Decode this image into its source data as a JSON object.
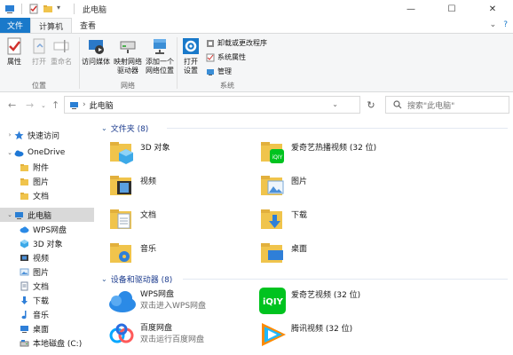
{
  "window": {
    "title": "此电脑",
    "controls": [
      "—",
      "☐",
      "✕"
    ]
  },
  "ribbon_tabs": {
    "file": "文件",
    "computer": "计算机",
    "view": "查看"
  },
  "ribbon": {
    "location": {
      "label": "位置",
      "properties": "属性",
      "open": "打开",
      "rename": "重命名"
    },
    "network": {
      "label": "网络",
      "access_media": "访问媒体",
      "map_drive_1": "映射网络",
      "map_drive_2": "驱动器",
      "add_location_1": "添加一个",
      "add_location_2": "网络位置"
    },
    "system": {
      "label": "系统",
      "open_settings_1": "打开",
      "open_settings_2": "设置",
      "uninstall": "卸载或更改程序",
      "system_properties": "系统属性",
      "manage": "管理"
    }
  },
  "address": {
    "path": "此电脑",
    "search_placeholder": "搜索\"此电脑\""
  },
  "nav": {
    "quick_access": "快速访问",
    "onedrive": "OneDrive",
    "attachments": "附件",
    "pictures": "图片",
    "documents": "文档",
    "this_pc": "此电脑",
    "wps_drive": "WPS网盘",
    "objects3d": "3D 对象",
    "videos": "视频",
    "pictures2": "图片",
    "documents2": "文档",
    "downloads": "下载",
    "music": "音乐",
    "desktop": "桌面",
    "local_disk": "本地磁盘 (C:)"
  },
  "folders": {
    "header": "文件夹 (8)",
    "items": [
      "3D 对象",
      "爱奇艺热播视频 (32 位)",
      "视频",
      "图片",
      "文档",
      "下载",
      "音乐",
      "桌面"
    ]
  },
  "devices": {
    "header": "设备和驱动器 (8)",
    "items": [
      {
        "name": "WPS网盘",
        "sub": "双击进入WPS网盘"
      },
      {
        "name": "爱奇艺视频 (32 位)",
        "sub": ""
      },
      {
        "name": "百度网盘",
        "sub": "双击运行百度网盘"
      },
      {
        "name": "腾讯视频 (32 位)",
        "sub": ""
      }
    ]
  },
  "colors": {
    "file_tab": "#1979ca",
    "folder_yellow": "#f0c44c",
    "header_blue": "#1e3d8f",
    "selected_nav": "#d9d9d9",
    "iqiyi_green": "#00c31f"
  }
}
